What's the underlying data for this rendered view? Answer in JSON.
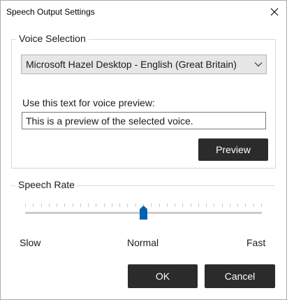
{
  "window": {
    "title": "Speech Output Settings"
  },
  "voice_selection": {
    "legend": "Voice Selection",
    "selected_voice": "Microsoft Hazel Desktop - English (Great Britain)",
    "preview_label": "Use this text for voice preview:",
    "preview_text": "This is a preview of the selected voice.",
    "preview_button": "Preview"
  },
  "speech_rate": {
    "legend": "Speech Rate",
    "value_fraction": 0.5,
    "tick_count": 31,
    "labels": {
      "slow": "Slow",
      "normal": "Normal",
      "fast": "Fast"
    }
  },
  "footer": {
    "ok": "OK",
    "cancel": "Cancel"
  },
  "colors": {
    "accent": "#0063b1",
    "button_dark": "#2b2b2b"
  }
}
